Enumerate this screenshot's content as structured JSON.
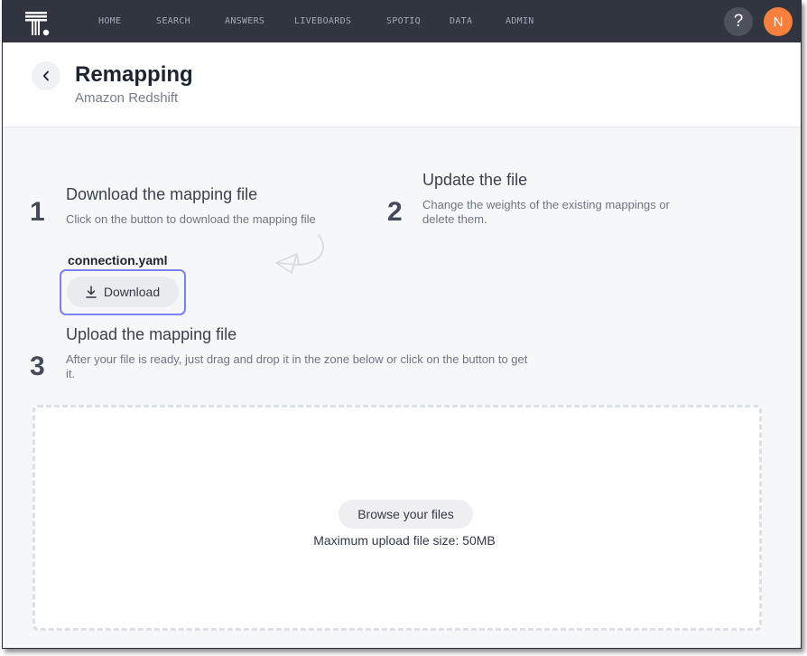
{
  "nav": {
    "items": [
      "HOME",
      "SEARCH",
      "ANSWERS",
      "LIVEBOARDS",
      "SPOTIQ",
      "DATA",
      "ADMIN"
    ],
    "help_label": "?",
    "avatar_initial": "N"
  },
  "header": {
    "title": "Remapping",
    "subtitle": "Amazon Redshift"
  },
  "steps": [
    {
      "number": "1",
      "title": "Download the mapping file",
      "description": "Click on the button to download the mapping file"
    },
    {
      "number": "2",
      "title": "Update the file",
      "description": "Change the weights of the existing mappings or delete them."
    },
    {
      "number": "3",
      "title": "Upload the mapping file",
      "description": "After your file is ready, just drag and drop it in the zone below or click on the button to get it."
    }
  ],
  "download": {
    "filename": "connection.yaml",
    "button_label": "Download"
  },
  "upload": {
    "browse_label": "Browse your files",
    "max_size_text": "Maximum upload file size: 50MB"
  },
  "colors": {
    "nav_bg": "#31353f",
    "avatar_bg": "#f97f3d",
    "focus_ring": "#7b80f0"
  }
}
